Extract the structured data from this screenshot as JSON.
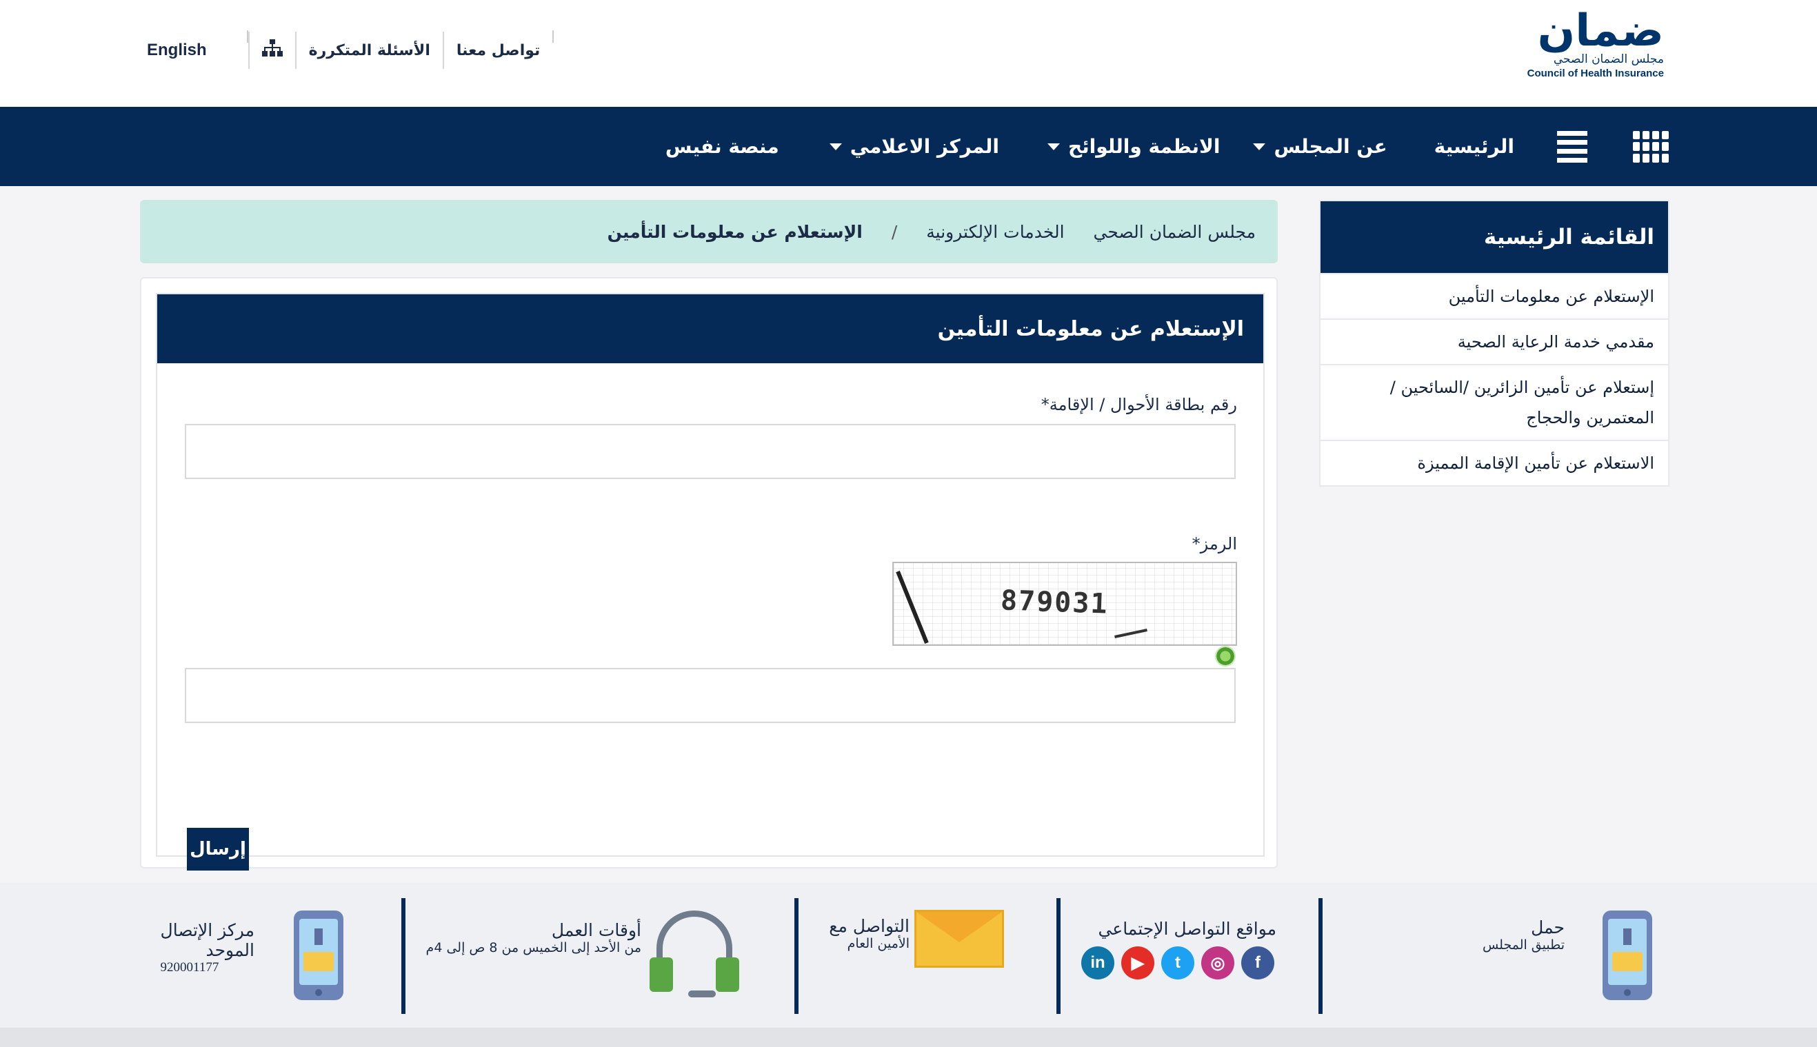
{
  "header": {
    "logo": {
      "wordmark": "ضمان",
      "subtitle_ar": "مجلس الضمان الصحي",
      "subtitle_en": "Council of Health Insurance"
    },
    "links": {
      "contact": "تواصل معنا",
      "faq": "الأسئلة المتكررة",
      "sitemap_icon": "sitemap-icon",
      "language": "English"
    }
  },
  "nav": {
    "grid_icon": "apps-grid-icon",
    "menu_icon": "hamburger-menu-icon",
    "items": [
      {
        "label": "الرئيسية",
        "dropdown": false
      },
      {
        "label": "عن المجلس",
        "dropdown": true
      },
      {
        "label": "الانظمة واللوائح",
        "dropdown": true
      },
      {
        "label": "المركز الاعلامي",
        "dropdown": true
      },
      {
        "label": "منصة نفيس",
        "dropdown": false
      }
    ]
  },
  "breadcrumb": {
    "home": "مجلس الضمان الصحي",
    "section": "الخدمات الإلكترونية",
    "separator": "/",
    "current": "الإستعلام عن معلومات التأمين"
  },
  "sidebar": {
    "title": "القائمة الرئيسية",
    "items": [
      "الإستعلام عن معلومات التأمين",
      "مقدمي خدمة الرعاية الصحية",
      "إستعلام عن تأمين الزائرين /السائحين / المعتمرين والحجاج",
      "الاستعلام عن تأمين الإقامة المميزة"
    ]
  },
  "form": {
    "title": "الإستعلام عن معلومات التأمين",
    "id_label": "رقم بطاقة الأحوال / الإقامة*",
    "id_value": "",
    "code_label": "الرمز*",
    "captcha_text": "879031",
    "code_value": "",
    "refresh_icon": "refresh-icon",
    "submit_label": "إرسال"
  },
  "footer": {
    "app": {
      "line1": "حمل",
      "line2": "تطبيق المجلس",
      "icon": "phone-download-icon"
    },
    "social": {
      "title": "مواقع التواصل الإجتماعي",
      "icons": [
        {
          "name": "facebook-icon",
          "glyph": "f",
          "color": "#3b5998"
        },
        {
          "name": "instagram-icon",
          "glyph": "◎",
          "color": "#c13584"
        },
        {
          "name": "twitter-icon",
          "glyph": "t",
          "color": "#1da1f2"
        },
        {
          "name": "youtube-icon",
          "glyph": "▶",
          "color": "#e52d27"
        },
        {
          "name": "linkedin-icon",
          "glyph": "in",
          "color": "#0e76a8"
        }
      ]
    },
    "contact": {
      "line1": "التواصل مع",
      "line2": "الأمين العام",
      "icon": "mail-icon"
    },
    "hours": {
      "line1": "أوقات العمل",
      "line2": "من الأحد إلى الخميس من 8 ص إلى 4م",
      "icon": "headset-icon"
    },
    "callcenter": {
      "line1": "مركز الإتصال",
      "line2": "الموحد",
      "number": "920001177",
      "icon": "phone-download-icon"
    }
  },
  "colors": {
    "primary": "#062a58",
    "accent": "#3cc6a7",
    "breadcrumb_bg": "#c7ebe4"
  }
}
